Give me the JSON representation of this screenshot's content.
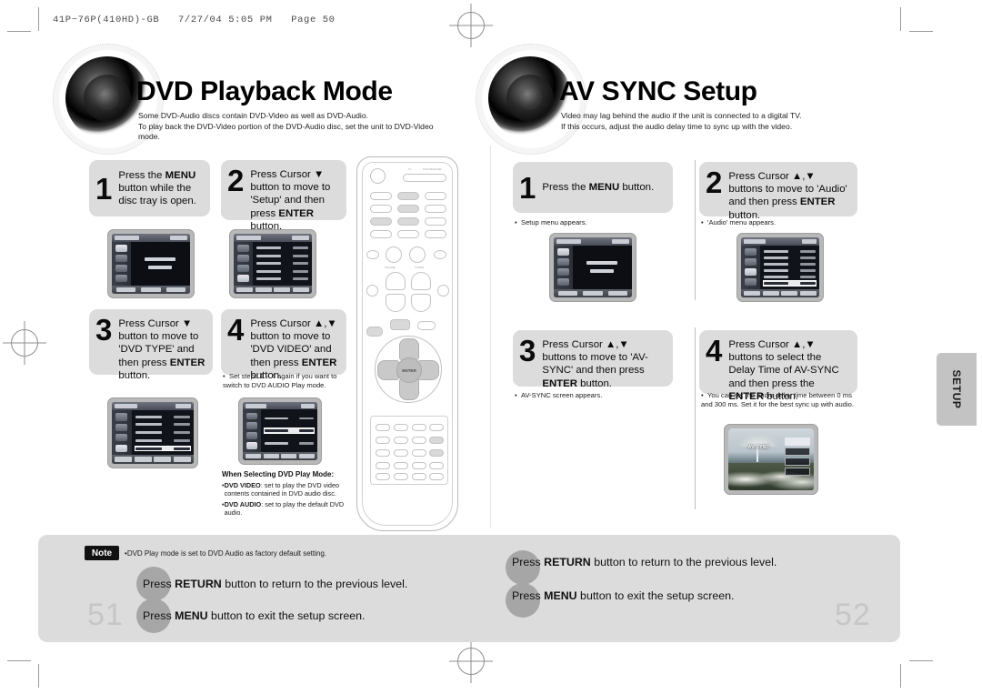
{
  "slug": "41P~76P(410HD)-GB   7/27/04 5:05 PM   Page 50",
  "left_page": {
    "title": "DVD Playback Mode",
    "subtitle": "Some DVD-Audio discs contain DVD-Video as well as DVD-Audio.\nTo play back the DVD-Video portion of the DVD-Audio disc, set the unit to DVD-Video mode.",
    "steps": [
      {
        "num": "1",
        "text_html": "Press the <b>MENU</b> button while the disc tray is open."
      },
      {
        "num": "2",
        "text_html": "Press Cursor ▼ button to move to 'Setup' and then press <b>ENTER</b> button."
      },
      {
        "num": "3",
        "text_html": "Press Cursor ▼ button to move to 'DVD TYPE' and then press <b>ENTER</b> button."
      },
      {
        "num": "4",
        "text_html": "Press Cursor ▲,▼ button to move to 'DVD VIDEO' and then press <b>ENTER</b> button."
      }
    ],
    "step4_note": "Set steps 1 ~ 4 again if you want to switch to DVD AUDIO Play mode.",
    "play_mode_heading": "When Selecting DVD Play Mode:",
    "play_mode_items": [
      {
        "term": "DVD VIDEO",
        "desc": ": set to play the DVD video contents contained in DVD audio disc."
      },
      {
        "term": "DVD AUDIO",
        "desc": ": set to play the default DVD audio."
      }
    ],
    "page_number": "51"
  },
  "right_page": {
    "title": "AV SYNC Setup",
    "subtitle": "Video may lag behind the audio if the unit is connected to a digital TV.\nIf this occurs, adjust the audio delay time to sync up with the video.",
    "steps": [
      {
        "num": "1",
        "text_html": "Press the <b>MENU</b> button."
      },
      {
        "num": "2",
        "text_html": "Press Cursor ▲,▼ buttons to move to 'Audio' and then press <b>ENTER</b> button."
      },
      {
        "num": "3",
        "text_html": "Press Cursor ▲,▼ buttons to move to 'AV-SYNC' and then press <b>ENTER</b> button."
      },
      {
        "num": "4",
        "text_html": "Press Cursor ▲,▼ buttons to select the Delay Time of AV-SYNC and then press the <b>ENTER</b> button."
      }
    ],
    "subnotes": [
      "Setup menu appears.",
      "'Audio' menu appears.",
      "AV-SYNC screen appears.",
      "You can set the audio delay time between 0 ms and 300 ms. Set it for the best sync up with audio."
    ],
    "page_number": "52"
  },
  "side_tab": {
    "label": "SETUP"
  },
  "bottom": {
    "note_chip": "Note",
    "note_text": "DVD Play mode is set to DVD Audio as factory default setting.",
    "left_lines": [
      {
        "html": "Press <b>RETURN</b> button to return to the previous level."
      },
      {
        "html": "Press <b>MENU</b> button to exit the setup screen."
      }
    ],
    "right_lines": [
      {
        "html": "Press <b>RETURN</b> button to return to the previous level."
      },
      {
        "html": "Press <b>MENU</b> button to exit the setup screen."
      }
    ]
  },
  "screen_captures": {
    "left_step1": "setup-menu-disc-tray-message",
    "left_step2": "setup-menu-list",
    "left_step3": "dvd-type-menu",
    "left_step4": "dvd-video-selected-menu",
    "right_step1": "setup-menu-screen",
    "right_step2": "audio-menu-screen",
    "right_step4": "av-sync-delay-screen"
  },
  "remote": {
    "label_tv": "TV",
    "label_dvd_receiver": "DVD RECEIVER",
    "enter_label": "ENTER"
  },
  "colors": {
    "callout_bg": "#dcdcdc",
    "page_number": "#c6c6c6",
    "note_chip_bg": "#111111",
    "tab_bg": "#c3c3c3"
  }
}
